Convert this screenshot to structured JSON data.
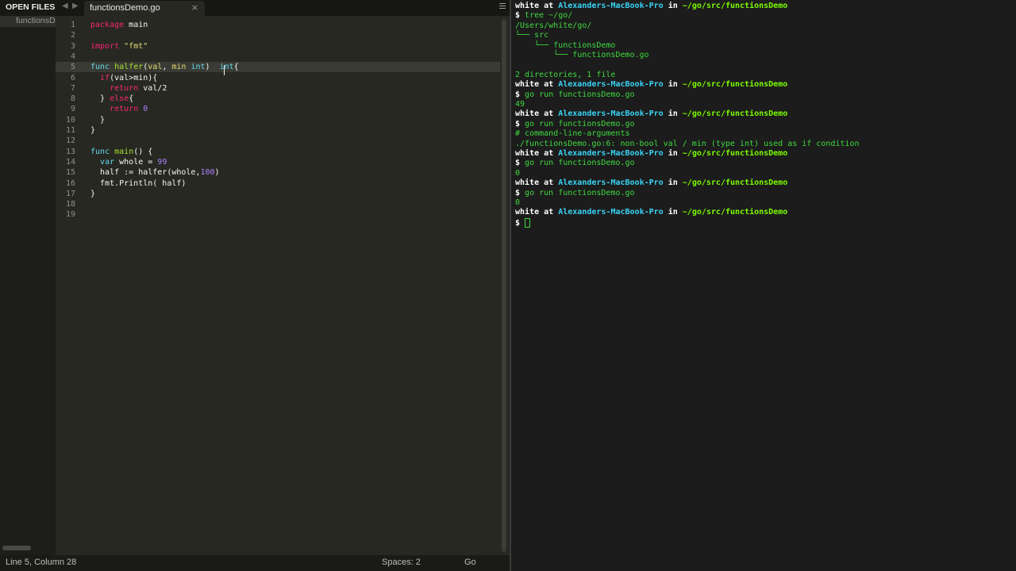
{
  "sidebar": {
    "title": "OPEN FILES",
    "open_file": "functionsDemo.go"
  },
  "tab": {
    "title": "functionsDemo.go",
    "close_glyph": "×"
  },
  "code_lines": [
    {
      "n": "1",
      "html": "<span class='flow'>package</span> main"
    },
    {
      "n": "2",
      "html": ""
    },
    {
      "n": "3",
      "html": "<span class='flow'>import</span> <span class='str'>\"fmt\"</span>"
    },
    {
      "n": "4",
      "html": ""
    },
    {
      "n": "5",
      "html": "<span class='kw'>func</span> <span class='fn'>halfer</span>(<span class='str'>val</span>, <span class='str'>min</span> <span class='kw'>int</span>)  <span class='kw'>int</span>{",
      "current": true
    },
    {
      "n": "6",
      "html": "  <span class='flow'>if</span>(val&gt;min){"
    },
    {
      "n": "7",
      "html": "    <span class='flow'>return</span> val/2"
    },
    {
      "n": "8",
      "html": "  } <span class='flow'>else</span>{"
    },
    {
      "n": "9",
      "html": "    <span class='flow'>return</span> <span class='num'>0</span>"
    },
    {
      "n": "10",
      "html": "  }"
    },
    {
      "n": "11",
      "html": "}"
    },
    {
      "n": "12",
      "html": ""
    },
    {
      "n": "13",
      "html": "<span class='kw'>func</span> <span class='fn'>main</span>() {"
    },
    {
      "n": "14",
      "html": "  <span class='kw'>var</span> whole = <span class='num'>99</span>"
    },
    {
      "n": "15",
      "html": "  half := halfer(whole,<span class='num'>100</span>)"
    },
    {
      "n": "16",
      "html": "  fmt.Println( half)"
    },
    {
      "n": "17",
      "html": "}"
    },
    {
      "n": "18",
      "html": ""
    },
    {
      "n": "19",
      "html": ""
    }
  ],
  "status": {
    "position": "Line 5, Column 28",
    "spaces": "Spaces: 2",
    "syntax": "Go"
  },
  "terminal_lines": [
    {
      "html": "<span class='t-user'>white</span> <span class='t-plain'>at</span> <span class='t-host'>Alexanders-MacBook-Pro</span> <span class='t-plain'>in</span> <span class='t-path'>~/go/src/functionsDemo</span>"
    },
    {
      "html": "<span class='t-plain'>$</span> tree ~/go/"
    },
    {
      "html": "/Users/white/go/"
    },
    {
      "html": "└── src"
    },
    {
      "html": "    └── functionsDemo"
    },
    {
      "html": "        └── functionsDemo.go"
    },
    {
      "html": ""
    },
    {
      "html": "2 directories, 1 file"
    },
    {
      "html": "<span class='t-user'>white</span> <span class='t-plain'>at</span> <span class='t-host'>Alexanders-MacBook-Pro</span> <span class='t-plain'>in</span> <span class='t-path'>~/go/src/functionsDemo</span>"
    },
    {
      "html": "<span class='t-plain'>$</span> go run functionsDemo.go"
    },
    {
      "html": "49"
    },
    {
      "html": "<span class='t-user'>white</span> <span class='t-plain'>at</span> <span class='t-host'>Alexanders-MacBook-Pro</span> <span class='t-plain'>in</span> <span class='t-path'>~/go/src/functionsDemo</span>"
    },
    {
      "html": "<span class='t-plain'>$</span> go run functionsDemo.go"
    },
    {
      "html": "# command-line-arguments"
    },
    {
      "html": "./functionsDemo.go:6: non-bool val / min (type int) used as if condition"
    },
    {
      "html": "<span class='t-user'>white</span> <span class='t-plain'>at</span> <span class='t-host'>Alexanders-MacBook-Pro</span> <span class='t-plain'>in</span> <span class='t-path'>~/go/src/functionsDemo</span>"
    },
    {
      "html": "<span class='t-plain'>$</span> go run functionsDemo.go"
    },
    {
      "html": "0"
    },
    {
      "html": "<span class='t-user'>white</span> <span class='t-plain'>at</span> <span class='t-host'>Alexanders-MacBook-Pro</span> <span class='t-plain'>in</span> <span class='t-path'>~/go/src/functionsDemo</span>"
    },
    {
      "html": "<span class='t-plain'>$</span> go run functionsDemo.go"
    },
    {
      "html": "0"
    },
    {
      "html": "<span class='t-user'>white</span> <span class='t-plain'>at</span> <span class='t-host'>Alexanders-MacBook-Pro</span> <span class='t-plain'>in</span> <span class='t-path'>~/go/src/functionsDemo</span>"
    },
    {
      "html": "<span class='t-plain'>$</span> <span id='term-cursor'></span>"
    }
  ],
  "colors": {
    "editor_bg": "#272822",
    "terminal_bg": "#1c1c1c",
    "keyword": "#66d9ef",
    "string": "#e6db74",
    "terminal_green": "#3fd93f",
    "terminal_host": "#39d3f4"
  }
}
